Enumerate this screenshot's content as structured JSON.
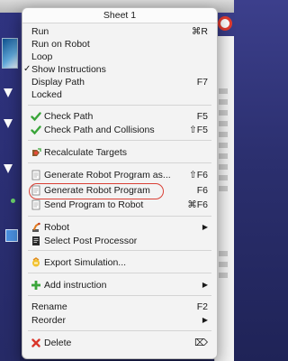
{
  "menu": {
    "title": "Sheet 1",
    "items": [
      {
        "label": "Run",
        "shortcut": "⌘R"
      },
      {
        "label": "Run on Robot",
        "shortcut": ""
      },
      {
        "label": "Loop",
        "shortcut": ""
      },
      {
        "label": "Show Instructions",
        "shortcut": "",
        "checked": true
      },
      {
        "label": "Display Path",
        "shortcut": "F7"
      },
      {
        "label": "Locked",
        "shortcut": ""
      },
      {
        "label": "Check Path",
        "shortcut": "F5",
        "icon": "green-check-icon"
      },
      {
        "label": "Check Path and Collisions",
        "shortcut": "⇧F5",
        "icon": "green-check-icon"
      },
      {
        "label": "Recalculate Targets",
        "shortcut": "",
        "icon": "recalculate-targets-icon"
      },
      {
        "label": "Generate Robot Program as...",
        "shortcut": "⇧F6",
        "icon": "document-icon"
      },
      {
        "label": "Generate Robot Program",
        "shortcut": "F6",
        "icon": "document-icon"
      },
      {
        "label": "Send Program to Robot",
        "shortcut": "⌘F6",
        "icon": "document-icon"
      },
      {
        "label": "Robot",
        "shortcut": "▶",
        "icon": "robot-icon"
      },
      {
        "label": "Select Post Processor",
        "shortcut": "",
        "icon": "post-processor-icon"
      },
      {
        "label": "Export Simulation...",
        "shortcut": "",
        "icon": "export-simulation-icon"
      },
      {
        "label": "Add instruction",
        "shortcut": "▶",
        "icon": "green-plus-icon"
      },
      {
        "label": "Rename",
        "shortcut": "F2"
      },
      {
        "label": "Reorder",
        "shortcut": "▶"
      },
      {
        "label": "Delete",
        "shortcut": "⌦",
        "icon": "red-x-icon"
      }
    ],
    "checkmark": "✓"
  },
  "colors": {
    "menu_bg": "#f3f3f3",
    "annotation": "#d94036",
    "check_green": "#3aa53a",
    "delete_red": "#d9362b",
    "desktop_bg": "#2b2f6e"
  }
}
